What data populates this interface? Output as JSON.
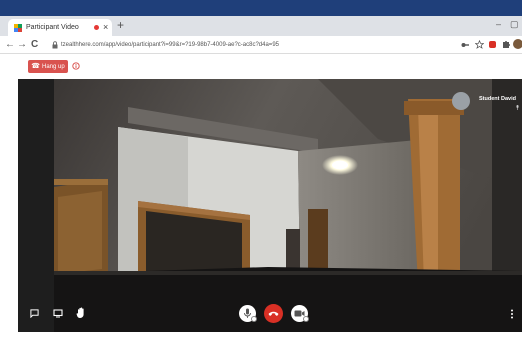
{
  "browser": {
    "tab_title": "Participant Video",
    "tab_close": "×",
    "new_tab": "+",
    "minimize": "–",
    "maximize": "▢",
    "url": "tzealthhere.com/app/video/participant?i=99&r=?19-98b7-4009-ae?c-ac8c?d4a=95",
    "nav_back": "←",
    "nav_forward": "→",
    "nav_reload": "C"
  },
  "toolbar": {
    "hangup_label": "Hang up",
    "hangup_color": "#d9534f"
  },
  "participant": {
    "name": "Student David"
  },
  "icons": {
    "tab_favicon": "tab-favicon-icon",
    "info": "info-icon",
    "chat": "chat-icon",
    "screen_share": "screen-share-icon",
    "raise_hand": "raise-hand-icon",
    "mic": "microphone-icon",
    "end_call": "end-call-icon",
    "camera": "camera-icon",
    "more": "more-options-icon"
  },
  "colors": {
    "end_call": "#d93025",
    "recording": "#e53935",
    "taskbar": "#1f3f7a"
  }
}
